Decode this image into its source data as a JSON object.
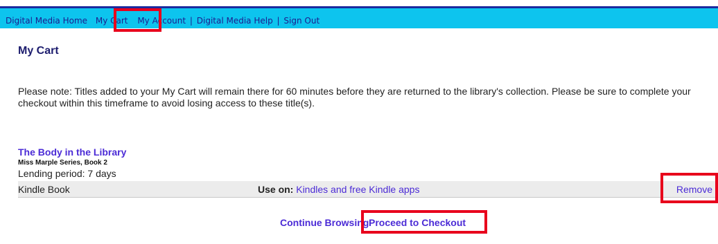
{
  "nav": {
    "items": [
      {
        "label": "Digital Media Home"
      },
      {
        "label": "My Cart"
      },
      {
        "label": "My Account"
      },
      {
        "label": "Digital Media Help"
      },
      {
        "label": "Sign Out"
      }
    ],
    "separator": "|"
  },
  "page": {
    "title": "My Cart",
    "notice": "Please note: Titles added to your My Cart will remain there for 60 minutes before they are returned to the library's collection. Please be sure to complete your checkout within this timeframe to avoid losing access to these title(s)."
  },
  "cart_item": {
    "title": "The Body in the Library",
    "series": "Miss Marple Series, Book 2",
    "lending_period": "Lending period: 7 days",
    "format": "Kindle Book",
    "use_on_label": "Use on:",
    "use_on_link": "Kindles and free Kindle apps",
    "remove_label": "Remove"
  },
  "actions": {
    "continue_label": "Continue Browsing",
    "checkout_label": "Proceed to Checkout"
  },
  "colors": {
    "nav_bar": "#0dc4ee",
    "link": "#4b2bd6",
    "highlight": "#e8001c"
  }
}
